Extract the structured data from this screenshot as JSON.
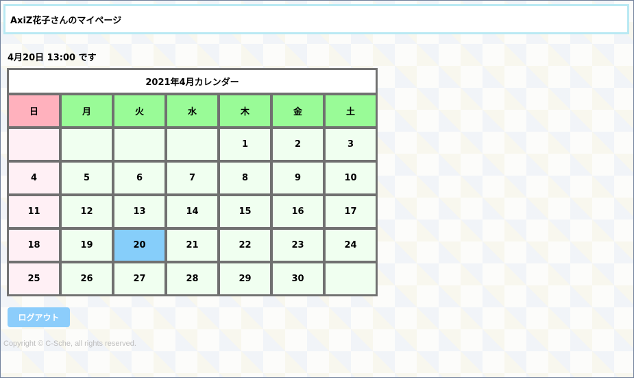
{
  "header": {
    "title": "AxiZ花子さんのマイページ"
  },
  "datetime": "4月20日 13:00 です",
  "calendar": {
    "title": "2021年4月カレンダー",
    "weekdays": [
      "日",
      "月",
      "火",
      "水",
      "木",
      "金",
      "土"
    ],
    "weeks": [
      [
        "",
        "",
        "",
        "",
        "1",
        "2",
        "3"
      ],
      [
        "4",
        "5",
        "6",
        "7",
        "8",
        "9",
        "10"
      ],
      [
        "11",
        "12",
        "13",
        "14",
        "15",
        "16",
        "17"
      ],
      [
        "18",
        "19",
        "20",
        "21",
        "22",
        "23",
        "24"
      ],
      [
        "25",
        "26",
        "27",
        "28",
        "29",
        "30",
        ""
      ]
    ],
    "today": "20",
    "colors": {
      "sunday_header": "#ffb1bd",
      "weekday_header": "#99fb97",
      "sunday_cell": "#fff0f5",
      "day_cell": "#f0fff0",
      "today_cell": "#86cefa"
    }
  },
  "logout_label": "ログアウト",
  "copyright": "Copyright © C-Sche, all rights reserved."
}
